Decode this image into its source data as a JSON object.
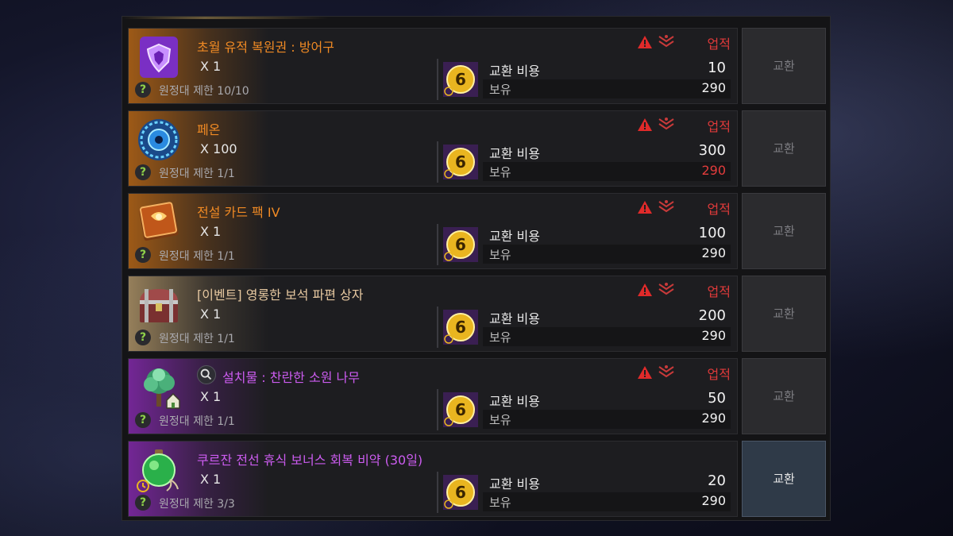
{
  "colors": {
    "name_orange": "#f08a24",
    "name_tan": "#e6c8a0",
    "name_purple": "#cc5cf0",
    "achievement_red": "#e03a3a",
    "insufficient_red": "#e33c3c",
    "limit_green": "#8fd24a"
  },
  "labels": {
    "cost": "교환 비용",
    "owned": "보유",
    "achievement": "업적",
    "exchange": "교환",
    "limit_prefix": "원정대 제한"
  },
  "items": [
    {
      "name": "초월 유적 복원권 : 방어구",
      "qty": "X 1",
      "limit": "원정대 제한 10/10",
      "cost": "10",
      "owned": "290",
      "owned_insufficient": false,
      "achievement": "업적",
      "exchange": "교환",
      "exchange_active": false,
      "icon": "purple-shield-scroll-icon",
      "grade": "orange"
    },
    {
      "name": "페온",
      "qty": "X 100",
      "limit": "원정대 제한 1/1",
      "cost": "300",
      "owned": "290",
      "owned_insufficient": true,
      "achievement": "업적",
      "exchange": "교환",
      "exchange_active": false,
      "icon": "blue-orb-icon",
      "grade": "orange"
    },
    {
      "name": "전설 카드 팩 IV",
      "qty": "X 1",
      "limit": "원정대 제한 1/1",
      "cost": "100",
      "owned": "290",
      "owned_insufficient": false,
      "achievement": "업적",
      "exchange": "교환",
      "exchange_active": false,
      "icon": "card-pack-icon",
      "grade": "orange"
    },
    {
      "name": "[이벤트] 영롱한 보석 파편 상자",
      "qty": "X 1",
      "limit": "원정대 제한 1/1",
      "cost": "200",
      "owned": "290",
      "owned_insufficient": false,
      "achievement": "업적",
      "exchange": "교환",
      "exchange_active": false,
      "icon": "treasure-chest-icon",
      "grade": "tan"
    },
    {
      "name": "설치물 : 찬란한 소원 나무",
      "qty": "X 1",
      "limit": "원정대 제한 1/1",
      "cost": "50",
      "owned": "290",
      "owned_insufficient": false,
      "achievement": "업적",
      "exchange": "교환",
      "exchange_active": false,
      "icon": "wish-tree-icon",
      "grade": "purple",
      "has_search": true
    },
    {
      "name": "쿠르잔 전선 휴식 보너스 회복 비약 (30일)",
      "qty": "X 1",
      "limit": "원정대 제한 3/3",
      "cost": "20",
      "owned": "290",
      "owned_insufficient": false,
      "achievement": "",
      "exchange": "교환",
      "exchange_active": true,
      "icon": "green-potion-icon",
      "grade": "purple"
    }
  ]
}
